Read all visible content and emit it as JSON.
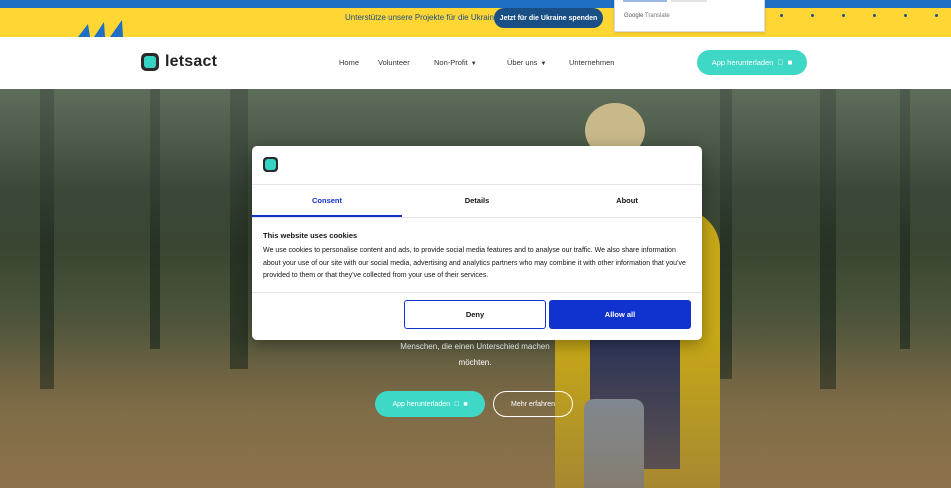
{
  "banner": {
    "text": "Unterstütze unsere Projekte für die Ukraine",
    "button": "Jetzt für die Ukraine spenden",
    "translate_label": "Google",
    "translate_label_suffix": "Translate",
    "colors": {
      "blue": "#1f6fc5",
      "yellow": "#ffd633"
    }
  },
  "nav": {
    "logo_text": "letsact",
    "items": [
      {
        "label": "Home"
      },
      {
        "label": "Volunteer"
      },
      {
        "label": "Non-Profit",
        "dropdown": true
      },
      {
        "label": "Über uns",
        "dropdown": true
      },
      {
        "label": "Unternehmen"
      }
    ],
    "cta": "App herunterladen",
    "cta_icons": [
      "apple-icon",
      "android-icon"
    ],
    "accent": "#3fd8c6"
  },
  "hero": {
    "subtitle_line1": "Menschen, die einen Unterschied machen",
    "subtitle_line2": "möchten.",
    "primary_button": "App herunterladen",
    "secondary_button": "Mehr erfahren"
  },
  "cookie_dialog": {
    "tabs": [
      {
        "label": "Consent",
        "active": true
      },
      {
        "label": "Details",
        "active": false
      },
      {
        "label": "About",
        "active": false
      }
    ],
    "title": "This website uses cookies",
    "body": "We use cookies to personalise content and ads, to provide social media features and to analyse our traffic. We also share information about your use of our site with our social media, advertising and analytics partners who may combine it with other information that you’ve provided to them or that they’ve collected from your use of their services.",
    "deny": "Deny",
    "allow": "Allow all",
    "accent": "#1032cf"
  }
}
